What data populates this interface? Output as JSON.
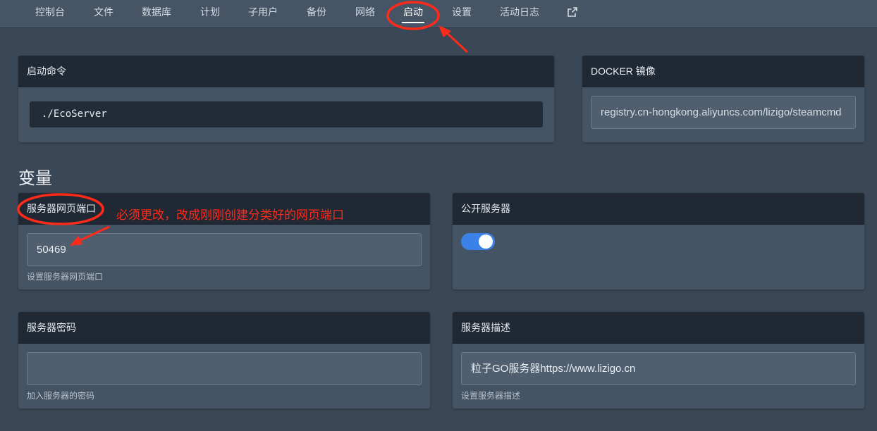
{
  "nav": {
    "items": [
      {
        "label": "控制台"
      },
      {
        "label": "文件"
      },
      {
        "label": "数据库"
      },
      {
        "label": "计划"
      },
      {
        "label": "子用户"
      },
      {
        "label": "备份"
      },
      {
        "label": "网络"
      },
      {
        "label": "启动"
      },
      {
        "label": "设置"
      },
      {
        "label": "活动日志"
      }
    ],
    "active": "启动",
    "external_icon": "external-link-icon"
  },
  "startup": {
    "title": "启动命令",
    "command": "./EcoServer"
  },
  "docker": {
    "title": "DOCKER 镜像",
    "image": "registry.cn-hongkong.aliyuncs.com/lizigo/steamcmd"
  },
  "variables": {
    "heading": "变量",
    "web_port": {
      "title": "服务器网页端口",
      "value": "50469",
      "help": "设置服务器网页端口"
    },
    "public_server": {
      "title": "公开服务器",
      "enabled": true
    },
    "password": {
      "title": "服务器密码",
      "value": "",
      "help": "加入服务器的密码"
    },
    "description": {
      "title": "服务器描述",
      "value": "粒子GO服务器https://www.lizigo.cn",
      "help": "设置服务器描述"
    }
  },
  "annotation": {
    "text": "必须更改，改成刚刚创建分类好的网页端口"
  },
  "colors": {
    "background": "#3a4756",
    "panel": "#455465",
    "panel_header": "#1f2833",
    "toggle_on": "#3b82e8",
    "annotation": "#ff2a1a"
  }
}
